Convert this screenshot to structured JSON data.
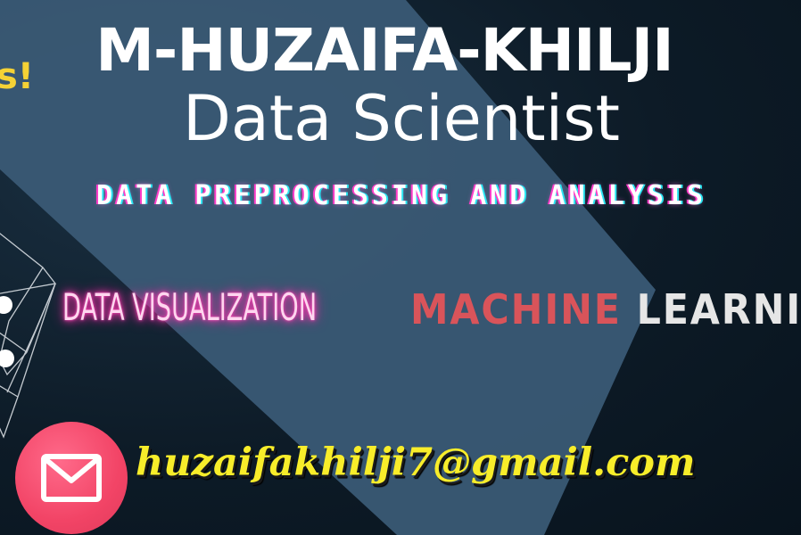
{
  "header": {
    "partial_text": "s!",
    "name": "M-HUZAIFA-KHILJI",
    "role": "Data Scientist"
  },
  "skills": {
    "preprocessing": "DATA PREPROCESSING AND ANALYSIS",
    "visualization": "DATA VISUALIZATION",
    "ml_word1": "MACHINE",
    "ml_word2": "LEARNING"
  },
  "contact": {
    "email": "huzaifakhilji7@gmail.com",
    "icon": "mail-icon"
  },
  "colors": {
    "background": "#0c1a26",
    "panel": "#3a5a75",
    "accent_yellow": "#f8ed2a",
    "accent_pink": "#ff3fb4",
    "accent_red": "#d9545a",
    "mail_circle": "#f24466"
  }
}
